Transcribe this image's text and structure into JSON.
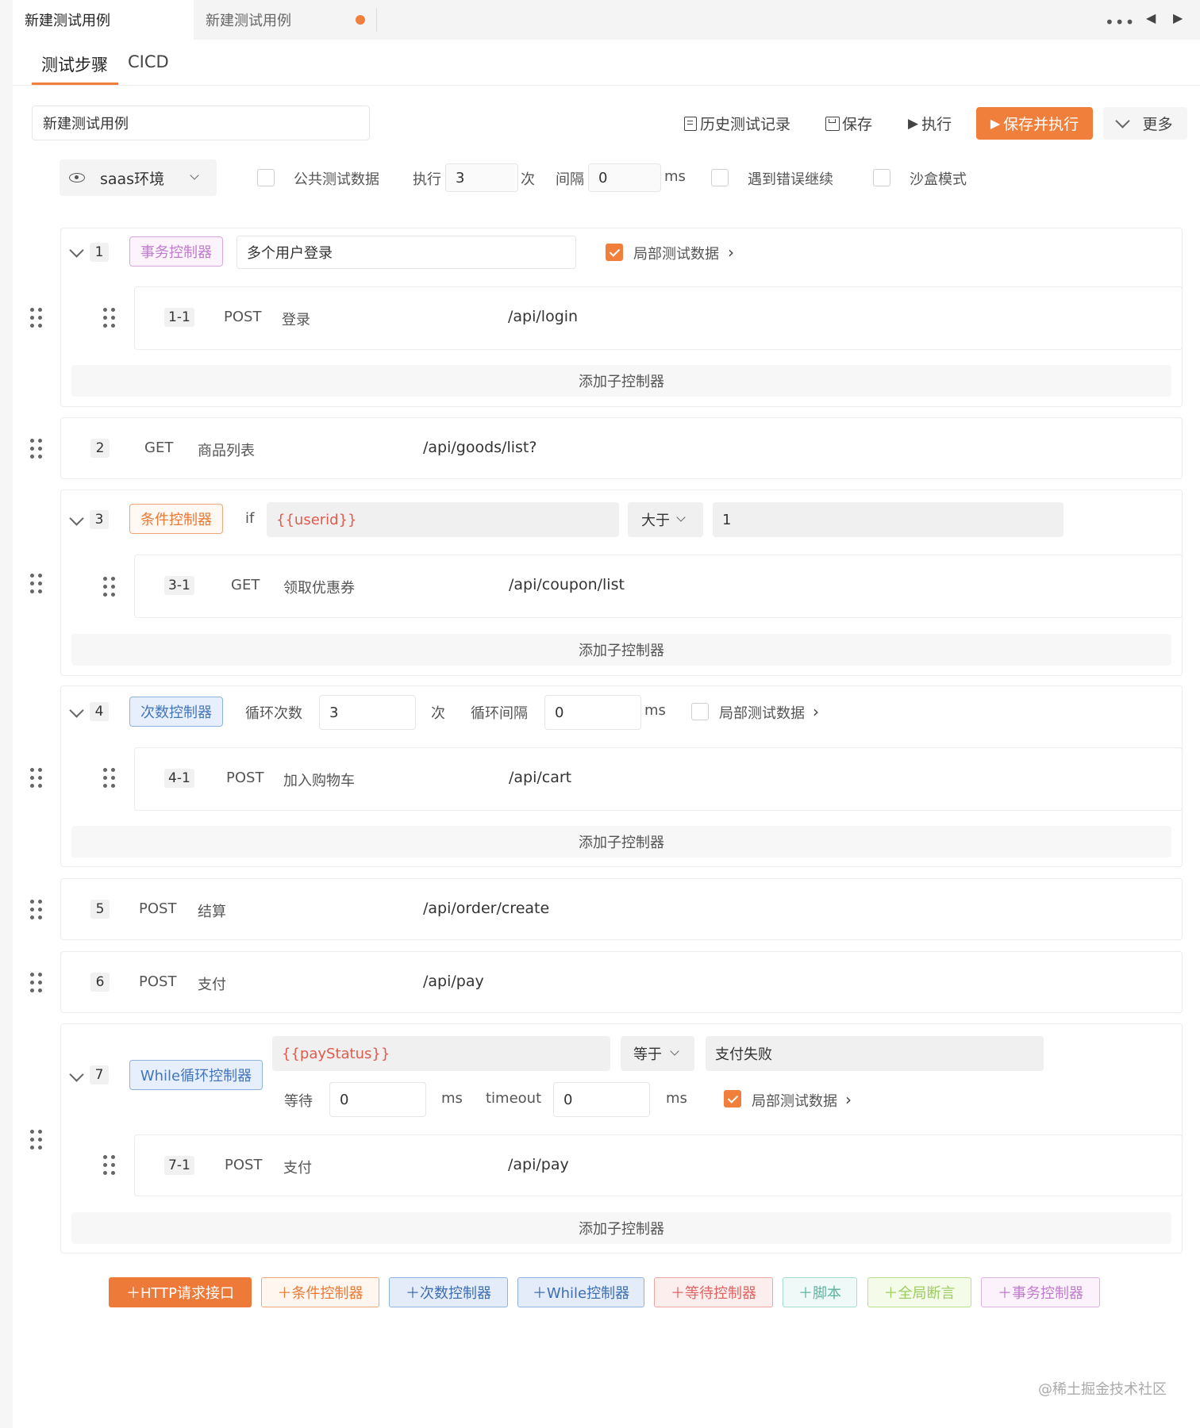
{
  "tabs": {
    "active": "新建测试用例",
    "second": "新建测试用例"
  },
  "subtabs": [
    "测试步骤",
    "CICD"
  ],
  "case_name": "新建测试用例",
  "toolbar": {
    "history": "历史测试记录",
    "save": "保存",
    "run": "执行",
    "save_run": "保存并执行",
    "more": "更多"
  },
  "env": {
    "label": "saas环境"
  },
  "options": {
    "public_data": "公共测试数据",
    "run_label": "执行",
    "run_times": "3",
    "times_unit": "次",
    "interval_label": "间隔",
    "interval": "0",
    "ms": "ms",
    "continue_on_error": "遇到错误继续",
    "sandbox": "沙盒模式"
  },
  "steps": {
    "s1": {
      "num": "1",
      "tag": "事务控制器",
      "name": "多个用户登录",
      "local": "局部测试数据",
      "child": {
        "num": "1-1",
        "method": "POST",
        "name": "登录",
        "path": "/api/login"
      }
    },
    "s2": {
      "num": "2",
      "method": "GET",
      "name": "商品列表",
      "path": "/api/goods/list?"
    },
    "s3": {
      "num": "3",
      "tag": "条件控制器",
      "if": "if",
      "var": "{{userid}}",
      "op": "大于",
      "value": "1",
      "child": {
        "num": "3-1",
        "method": "GET",
        "name": "领取优惠券",
        "path": "/api/coupon/list"
      }
    },
    "s4": {
      "num": "4",
      "tag": "次数控制器",
      "loop_count_label": "循环次数",
      "loop_count": "3",
      "times_unit": "次",
      "loop_interval_label": "循环间隔",
      "loop_interval": "0",
      "ms": "ms",
      "local": "局部测试数据",
      "child": {
        "num": "4-1",
        "method": "POST",
        "name": "加入购物车",
        "path": "/api/cart"
      }
    },
    "s5": {
      "num": "5",
      "method": "POST",
      "name": "结算",
      "path": "/api/order/create"
    },
    "s6": {
      "num": "6",
      "method": "POST",
      "name": "支付",
      "path": "/api/pay"
    },
    "s7": {
      "num": "7",
      "tag": "While循环控制器",
      "var": "{{payStatus}}",
      "op": "等于",
      "value": "支付失败",
      "wait_label": "等待",
      "wait": "0",
      "ms": "ms",
      "timeout_label": "timeout",
      "timeout": "0",
      "local": "局部测试数据",
      "child": {
        "num": "7-1",
        "method": "POST",
        "name": "支付",
        "path": "/api/pay"
      }
    }
  },
  "add_child": "添加子控制器",
  "add_buttons": [
    "＋HTTP请求接口",
    "＋条件控制器",
    "＋次数控制器",
    "＋While控制器",
    "＋等待控制器",
    "＋脚本",
    "＋全局断言",
    "＋事务控制器"
  ],
  "watermark": "@稀土掘金技术社区",
  "colors": {
    "accent": "#f07f3c"
  }
}
